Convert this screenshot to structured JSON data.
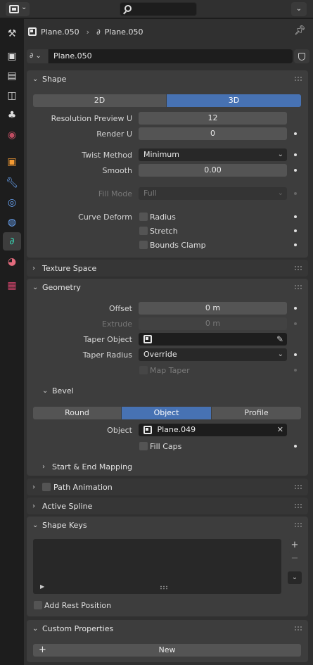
{
  "header": {
    "breadcrumb_object": "Plane.050",
    "breadcrumb_data": "Plane.050",
    "datablock_name": "Plane.050"
  },
  "shape": {
    "title": "Shape",
    "mode_2d": "2D",
    "mode_3d": "3D",
    "resolution_preview_label": "Resolution Preview U",
    "resolution_preview_value": "12",
    "render_u_label": "Render U",
    "render_u_value": "0",
    "twist_method_label": "Twist Method",
    "twist_method_value": "Minimum",
    "smooth_label": "Smooth",
    "smooth_value": "0.00",
    "fill_mode_label": "Fill Mode",
    "fill_mode_value": "Full",
    "curve_deform_label": "Curve Deform",
    "radius_label": "Radius",
    "stretch_label": "Stretch",
    "bounds_clamp_label": "Bounds Clamp"
  },
  "texture_space": {
    "title": "Texture Space"
  },
  "geometry": {
    "title": "Geometry",
    "offset_label": "Offset",
    "offset_value": "0 m",
    "extrude_label": "Extrude",
    "extrude_value": "0 m",
    "taper_object_label": "Taper Object",
    "taper_radius_label": "Taper Radius",
    "taper_radius_value": "Override",
    "map_taper_label": "Map Taper"
  },
  "bevel": {
    "title": "Bevel",
    "mode_round": "Round",
    "mode_object": "Object",
    "mode_profile": "Profile",
    "object_label": "Object",
    "object_value": "Plane.049",
    "fill_caps_label": "Fill Caps",
    "start_end_mapping": "Start & End Mapping"
  },
  "path_animation": {
    "title": "Path Animation"
  },
  "active_spline": {
    "title": "Active Spline"
  },
  "shape_keys": {
    "title": "Shape Keys",
    "add_rest_position_label": "Add Rest Position"
  },
  "custom_properties": {
    "title": "Custom Properties",
    "new_label": "New"
  },
  "colors": {
    "accent": "#4772b3",
    "panel": "#3d3d3d",
    "field": "#545454"
  }
}
